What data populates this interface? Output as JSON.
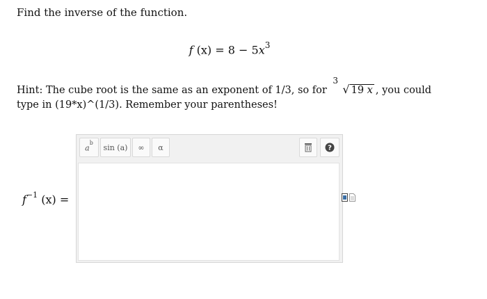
{
  "question": {
    "prompt": "Find the inverse of the function.",
    "function_lhs": "f",
    "function_arg": "(x)",
    "function_rhs": "= 8 − 5",
    "function_var": "x",
    "function_exp": "3",
    "hint_before": "Hint: The cube root is the same as an exponent of 1/3, so for",
    "hint_root_index": "3",
    "hint_radicand_num": "19",
    "hint_radicand_var": "x",
    "hint_after": ", you could type in (19*x)^(1/3). Remember your parentheses!"
  },
  "answer": {
    "label_f": "f",
    "label_exp": "−1",
    "label_arg": "(x) =",
    "value": ""
  },
  "toolbar": {
    "power_base": "a",
    "power_exp": "b",
    "sin_label": "sin (a)",
    "infinity_label": "∞",
    "alpha_label": "α"
  },
  "icons": [
    "power-icon",
    "sine-icon",
    "infinity-icon",
    "alpha-icon",
    "trash-icon",
    "help-icon",
    "preview-icon",
    "document-icon"
  ],
  "colors": {
    "editor_bg": "#f1f1f1",
    "help_bg": "#444444"
  }
}
